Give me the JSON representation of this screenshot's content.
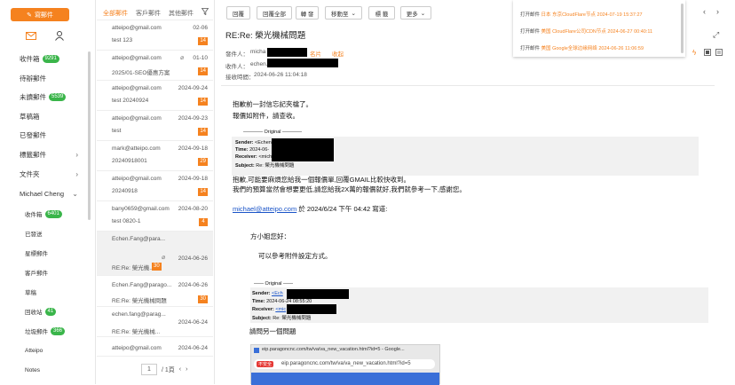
{
  "sidebar": {
    "compose_label": "寫郵件",
    "folders": [
      {
        "label": "收件箱",
        "count": "9291"
      },
      {
        "label": "待辦郵件",
        "count": ""
      },
      {
        "label": "未讀郵件",
        "count": "5539"
      },
      {
        "label": "草稿箱",
        "count": ""
      },
      {
        "label": "已發郵件",
        "count": ""
      },
      {
        "label": "標籤郵件",
        "count": ""
      },
      {
        "label": "文件夾",
        "count": ""
      }
    ],
    "account": "Michael Cheng",
    "sub": [
      {
        "label": "收件箱",
        "count": "6401"
      },
      {
        "label": "已發送",
        "count": ""
      },
      {
        "label": "星標郵件",
        "count": ""
      },
      {
        "label": "客戶郵件",
        "count": ""
      },
      {
        "label": "草稿",
        "count": ""
      },
      {
        "label": "回收站",
        "count": "41"
      },
      {
        "label": "垃圾郵件",
        "count": "366"
      },
      {
        "label": "Atteipo",
        "count": ""
      },
      {
        "label": "Notes",
        "count": ""
      }
    ]
  },
  "list": {
    "tabs": [
      "全部郵件",
      "客戶郵件",
      "其他郵件"
    ],
    "mails": [
      {
        "from": "atteipo@gmail.com",
        "date": "02-06",
        "subject": "test 123",
        "badge": "14"
      },
      {
        "from": "atteipo@gmail.com",
        "date": "01-10",
        "subject": "2025/01-SEO優惠方案",
        "badge": "14"
      },
      {
        "from": "atteipo@gmail.com",
        "date": "2024-09-24",
        "subject": "test 20240924",
        "badge": "14"
      },
      {
        "from": "atteipo@gmail.com",
        "date": "2024-09-23",
        "subject": "test",
        "badge": "14"
      },
      {
        "from": "mark@atteipo.com",
        "date": "2024-09-18",
        "subject": "20240918001",
        "badge": "29"
      },
      {
        "from": "atteipo@gmail.com",
        "date": "2024-09-18",
        "subject": "20240918",
        "badge": "14"
      },
      {
        "from": "bany0659@gmail.com",
        "date": "2024-08-20",
        "subject": "test 0820-1",
        "badge": "4"
      },
      {
        "from": "Echen.Fang@para...",
        "date": "2024-06-26",
        "subject": "RE:Re: 榮光機...",
        "badge": "30"
      },
      {
        "from": "Echen.Fang@parago...",
        "date": "2024-06-26",
        "subject": "RE:Re: 榮光機械問題",
        "badge": "30"
      },
      {
        "from": "echen.fang@parag...",
        "date": "2024-06-24",
        "subject": "RE:Re: 榮光機械...",
        "badge": ""
      },
      {
        "from": "atteipo@gmail.com",
        "date": "2024-06-24",
        "subject": "",
        "badge": ""
      }
    ],
    "page": "1",
    "pages": "/ 1頁"
  },
  "toolbar": [
    "回覆",
    "回覆全部",
    "轉 發",
    "移動至",
    "標 籤",
    "更多"
  ],
  "message": {
    "subject": "RE:Re: 榮光機械問題",
    "from_label": "發件人：",
    "from": "micha",
    "from_tag": "名片",
    "from_tag2": "收起",
    "to_label": "收件人：",
    "to": "echen.",
    "time_label": "接收時間：",
    "time": "2024-06-26 11:04:18",
    "line1": "抱歉前一封信忘記夾檔了。",
    "line2": "報價如附件，請查收。",
    "original": "Original",
    "sender_label": "Sender:",
    "sender": "<Echen.Fa",
    "time2_label": "Time:",
    "time2": "2024-06-",
    "receiver_label": "Receiver:",
    "receiver": "<michaeli",
    "subject_label": "Subject:",
    "subject2": "Re: 榮光機械問題",
    "body2": "抱歉,可能要麻煩您給我一個報價單,回覆GMAIL比較快收到。",
    "body3": "我們的預算當然會想要更低,請您給我2X萬的報價就好,我們就參考一下,感謝您。",
    "quote_link": "michael@atteipo.com",
    "quote_text": "於 2024/6/24 下午 04:42 寫道:",
    "greet": "方小姐您好：",
    "ref": "可以參考附件設定方式。",
    "o2_sender": "<Ech",
    "o2_time": "2024-06-24 08:55:20",
    "o2_receiver": "<mic",
    "o2_subject": "Re: 榮光機械問題",
    "ask": "請問另一個問題",
    "browser_title": "eip.paragoncnc.com/tw/va/va_new_vacation.html?id=5 - Google...",
    "browser_unsafe": "不安全",
    "browser_url": "eip.paragoncnc.com/tw/va/va_new_vacation.html?id=5"
  },
  "notifications": [
    {
      "action": "打开邮件",
      "text": "日本 东京CloudFlare节点 2024-07-19 15:37:27"
    },
    {
      "action": "打开邮件",
      "text": "美国 CloudFlare公司CDN节点 2024-06-27 00:40:11"
    },
    {
      "action": "打开邮件",
      "text": "美国 Google全球边缘网络 2024-06-26 11:06:59"
    }
  ],
  "colors": {
    "accent": "#f5821f",
    "green": "#3ab54a",
    "link": "#1a54c8"
  }
}
